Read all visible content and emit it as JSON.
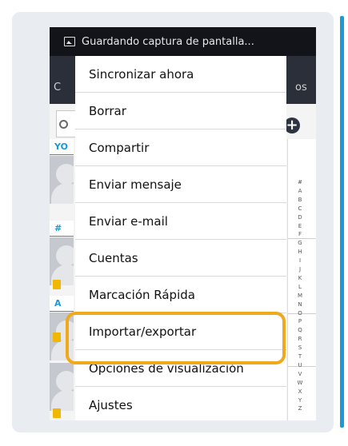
{
  "notification": {
    "text": "Guardando captura de pantalla..."
  },
  "tabs": {
    "left_fragment": "C",
    "right_fragment": "os"
  },
  "sections": [
    "YO",
    "#",
    "A"
  ],
  "index_letters": [
    "#",
    "A",
    "B",
    "C",
    "D",
    "E",
    "F",
    "G",
    "H",
    "I",
    "J",
    "K",
    "L",
    "M",
    "N",
    "O",
    "P",
    "Q",
    "R",
    "S",
    "T",
    "U",
    "V",
    "W",
    "X",
    "Y",
    "Z"
  ],
  "menu": {
    "items": [
      {
        "label": "Sincronizar ahora"
      },
      {
        "label": "Borrar"
      },
      {
        "label": "Compartir"
      },
      {
        "label": "Enviar mensaje"
      },
      {
        "label": "Enviar e-mail"
      },
      {
        "label": "Cuentas"
      },
      {
        "label": "Marcación Rápida"
      },
      {
        "label": "Importar/exportar"
      },
      {
        "label": "Opciones de visualización"
      },
      {
        "label": "Ajustes"
      }
    ],
    "highlighted": "Importar/exportar"
  },
  "colors": {
    "accent": "#1a9ad6",
    "highlight": "#f0a81c",
    "sim": "#f0b800"
  }
}
